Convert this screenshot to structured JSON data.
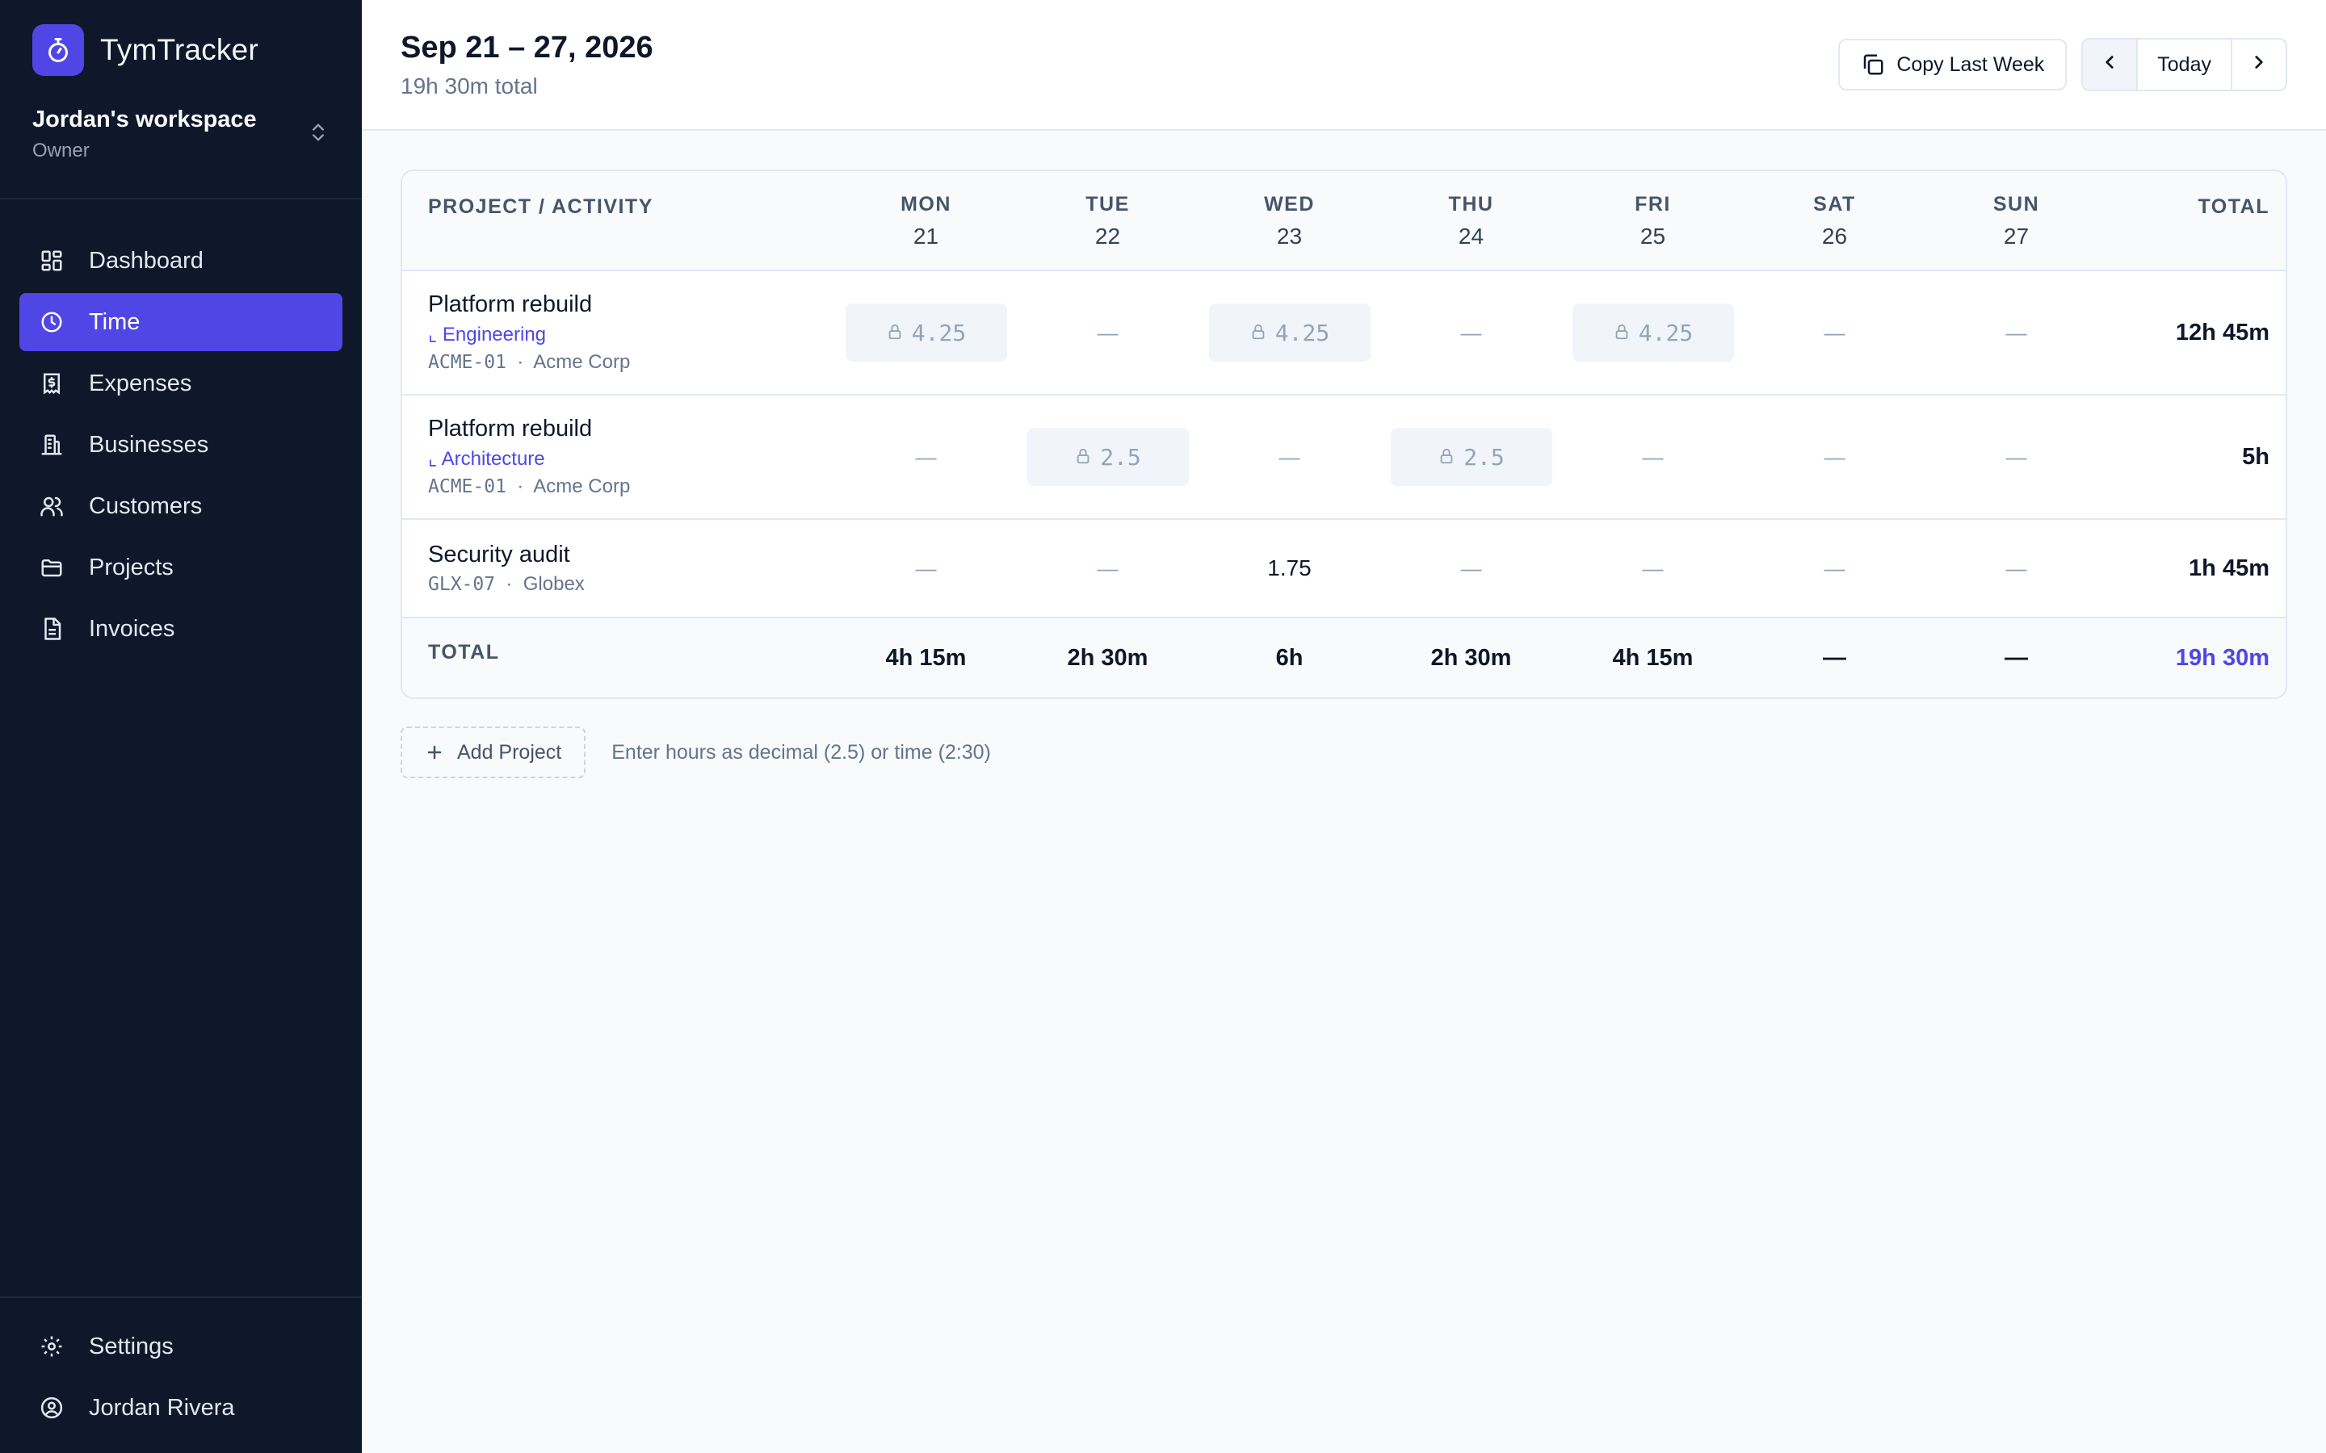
{
  "app": {
    "name": "TymTracker"
  },
  "workspace": {
    "name": "Jordan's workspace",
    "role": "Owner"
  },
  "nav": {
    "items": [
      {
        "label": "Dashboard",
        "icon": "dashboard-icon"
      },
      {
        "label": "Time",
        "icon": "clock-icon",
        "active": true
      },
      {
        "label": "Expenses",
        "icon": "receipt-icon"
      },
      {
        "label": "Businesses",
        "icon": "building-icon"
      },
      {
        "label": "Customers",
        "icon": "users-icon"
      },
      {
        "label": "Projects",
        "icon": "folder-icon"
      },
      {
        "label": "Invoices",
        "icon": "file-icon"
      }
    ],
    "settings": "Settings",
    "user": "Jordan Rivera"
  },
  "header": {
    "title": "Sep 21 – 27, 2026",
    "subtitle": "19h 30m total",
    "copy_last_week": "Copy Last Week",
    "today": "Today"
  },
  "table": {
    "col_project": "PROJECT / ACTIVITY",
    "col_total": "TOTAL",
    "days": [
      {
        "name": "MON",
        "num": "21"
      },
      {
        "name": "TUE",
        "num": "22"
      },
      {
        "name": "WED",
        "num": "23"
      },
      {
        "name": "THU",
        "num": "24"
      },
      {
        "name": "FRI",
        "num": "25"
      },
      {
        "name": "SAT",
        "num": "26"
      },
      {
        "name": "SUN",
        "num": "27"
      }
    ],
    "rows": [
      {
        "name": "Platform rebuild",
        "activity": "Engineering",
        "code": "ACME-01",
        "client": "Acme Corp",
        "cells": [
          "4.25",
          "—",
          "4.25",
          "—",
          "4.25",
          "—",
          "—"
        ],
        "locked": [
          true,
          false,
          true,
          false,
          true,
          false,
          false
        ],
        "total": "12h 45m"
      },
      {
        "name": "Platform rebuild",
        "activity": "Architecture",
        "code": "ACME-01",
        "client": "Acme Corp",
        "cells": [
          "—",
          "2.5",
          "—",
          "2.5",
          "—",
          "—",
          "—"
        ],
        "locked": [
          false,
          true,
          false,
          true,
          false,
          false,
          false
        ],
        "total": "5h"
      },
      {
        "name": "Security audit",
        "activity": "",
        "code": "GLX-07",
        "client": "Globex",
        "cells": [
          "—",
          "—",
          "1.75",
          "—",
          "—",
          "—",
          "—"
        ],
        "locked": [
          false,
          false,
          false,
          false,
          false,
          false,
          false
        ],
        "total": "1h 45m"
      }
    ],
    "footer": {
      "label": "TOTAL",
      "days": [
        "4h 15m",
        "2h 30m",
        "6h",
        "2h 30m",
        "4h 15m",
        "—",
        "—"
      ],
      "grand": "19h 30m"
    }
  },
  "actions": {
    "add_project": "Add Project",
    "hint": "Enter hours as decimal (2.5) or time (2:30)"
  },
  "colors": {
    "accent": "#4f46e5",
    "sidebar": "#0f172a"
  }
}
